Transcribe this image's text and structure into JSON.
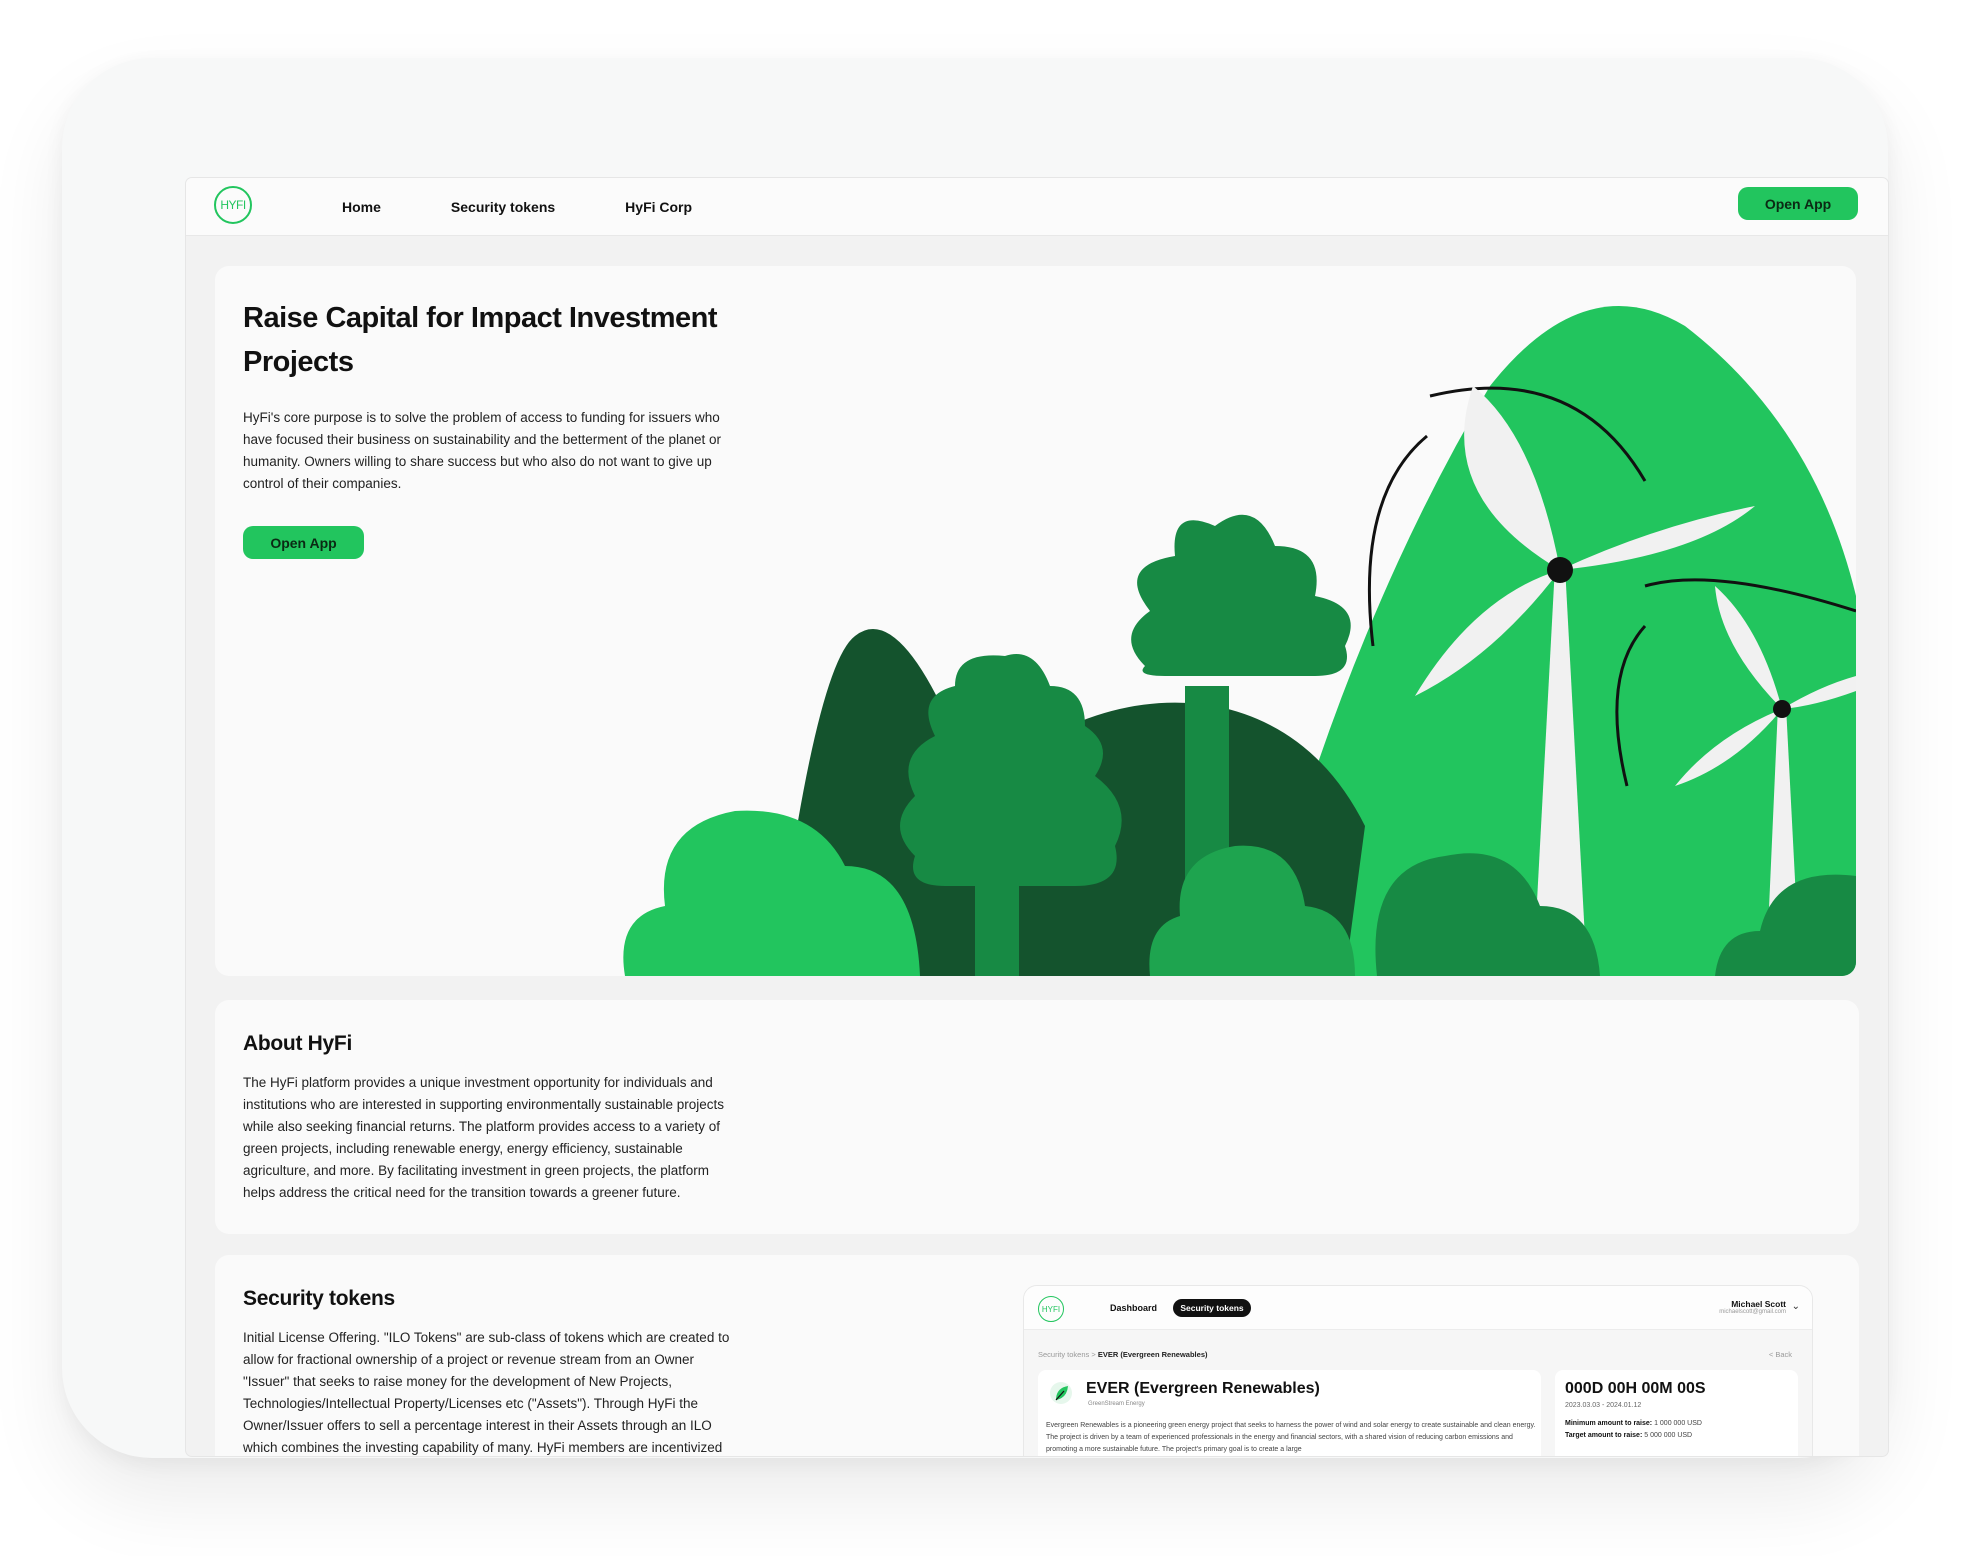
{
  "nav": {
    "logo_text": "HYFI",
    "links": [
      "Home",
      "Security tokens",
      "HyFi Corp"
    ],
    "open_app": "Open App"
  },
  "hero": {
    "title": "Raise Capital for Impact Investment Projects",
    "text": "HyFi's core purpose is to solve the problem of access to funding for issuers who have focused their business on sustainability and the betterment of the planet or humanity. Owners willing to share success but who also do not want to give up control of their companies.",
    "button": "Open App"
  },
  "about": {
    "title": "About HyFi",
    "text": "The HyFi platform provides a unique investment opportunity for individuals and institutions who are interested in supporting environmentally sustainable projects while also seeking financial returns. The platform provides access to a variety of green projects, including renewable energy, energy efficiency, sustainable agriculture, and more. By facilitating investment in green projects, the platform helps address the critical need for the transition towards a greener future."
  },
  "tokens": {
    "title": "Security tokens",
    "text": "Initial License Offering. \"ILO Tokens\" are sub-class of tokens which are created to allow for fractional ownership of a project or revenue stream from an Owner \"Issuer\" that seeks to raise money for the development of New Projects, Technologies/Intellectual Property/Licenses etc (\"Assets\"). Through HyFi the Owner/Issuer offers to sell a percentage interest in their Assets through an ILO which combines the investing capability of many. HyFi members are incentivized"
  },
  "preview": {
    "logo_text": "HYFI",
    "nav_dashboard": "Dashboard",
    "nav_security_tokens": "Security tokens",
    "user_name": "Michael Scott",
    "user_email": "michaelscott@gmail.com",
    "breadcrumb_root": "Security tokens",
    "breadcrumb_sep": ">",
    "breadcrumb_current": "EVER (Evergreen Renewables)",
    "back": "< Back",
    "project_title": "EVER (Evergreen Renewables)",
    "project_subtitle": "GreenStream Energy",
    "project_desc": "Evergreen Renewables is a pioneering green energy project that seeks to harness the power of wind and solar energy to create sustainable and clean energy. The project is driven by a team of experienced professionals in the energy and financial sectors, with a shared vision of reducing carbon emissions and promoting a more sustainable future. The project's primary goal is to create a large",
    "timer": "000D 00H 00M 00S",
    "dates": "2023.03.03 - 2024.01.12",
    "min_label": "Minimum amount to raise:",
    "min_value": "1 000 000 USD",
    "target_label": "Target amount to raise:",
    "target_value": "5 000 000 USD"
  },
  "colors": {
    "brand_green": "#22c55e",
    "dark_green": "#14532d",
    "mid_green": "#178a44"
  }
}
